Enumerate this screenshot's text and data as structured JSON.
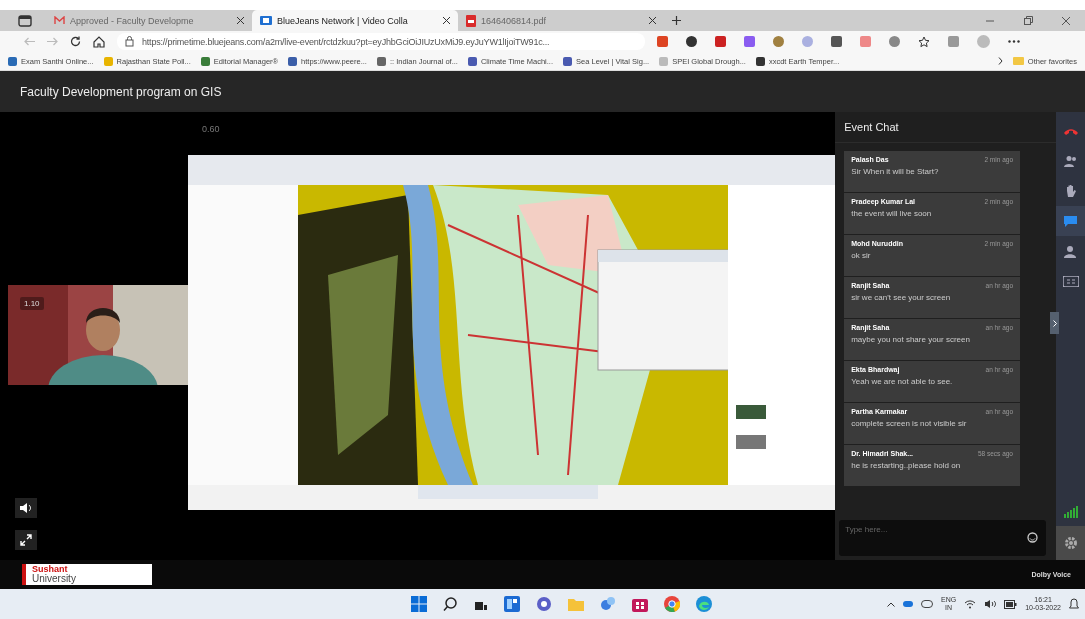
{
  "browser": {
    "tabs": [
      {
        "title": "Approved - Faculty Developme",
        "kind": "mail",
        "selected": false
      },
      {
        "title": "BlueJeans Network | Video Colla",
        "kind": "video",
        "selected": true
      },
      {
        "title": "1646406814.pdf",
        "kind": "pdf",
        "selected": false
      }
    ],
    "url": "https://primetime.bluejeans.com/a2m/live-event/rctdzkuu?pt=eyJhbGciOiJIUzUxMiJ9.eyJuYW1lIjoiTW91c...",
    "bookmarks": [
      "Exam Santhi Online...",
      "Rajasthan State Poll...",
      "Editorial Manager®",
      "https://www.peere...",
      ":: Indian Journal of...",
      "Climate Time Machi...",
      "Sea Level | Vital Sig...",
      "SPEI Global Drough...",
      "xxcdt Earth Temper..."
    ],
    "other_favorites": "Other favorites"
  },
  "event": {
    "title": "Faculty Development program on GIS",
    "stage_time": "0.60",
    "self_view_time": "1.10",
    "chat": {
      "title": "Event Chat",
      "messages": [
        {
          "name": "Palash Das",
          "time": "2 min ago",
          "text": "Sir When it will be Start?"
        },
        {
          "name": "Pradeep Kumar Lal",
          "time": "2 min ago",
          "text": "the event will live soon"
        },
        {
          "name": "Mohd Nuruddin",
          "time": "2 min ago",
          "text": "ok sir"
        },
        {
          "name": "Ranjit Saha",
          "time": "an hr ago",
          "text": "sir we can't see your screen"
        },
        {
          "name": "Ranjit Saha",
          "time": "an hr ago",
          "text": "maybe you not share your screen"
        },
        {
          "name": "Ekta Bhardwaj",
          "time": "an hr ago",
          "text": "Yeah we are not able to see."
        },
        {
          "name": "Partha Karmakar",
          "time": "an hr ago",
          "text": "complete screen is not visible sir"
        },
        {
          "name": "Dr. Himadri Shak...",
          "time": "58 secs ago",
          "text": "he is restarting..please hold on"
        }
      ],
      "input": {
        "placeholder": "Type here..."
      }
    },
    "rail": [
      {
        "kind": "phone",
        "selected": false
      },
      {
        "kind": "people",
        "selected": false
      },
      {
        "kind": "hand",
        "selected": false
      },
      {
        "kind": "chat",
        "selected": true
      },
      {
        "kind": "share",
        "selected": false
      },
      {
        "kind": "captions",
        "selected": false
      }
    ]
  },
  "footer": {
    "logo_top": "Sushant",
    "logo_bottom": "University",
    "audio": "Dolby Voice"
  },
  "taskbar": {
    "lang": "ENG",
    "region": "IN",
    "time": "16:21",
    "date": "10-03-2022"
  }
}
